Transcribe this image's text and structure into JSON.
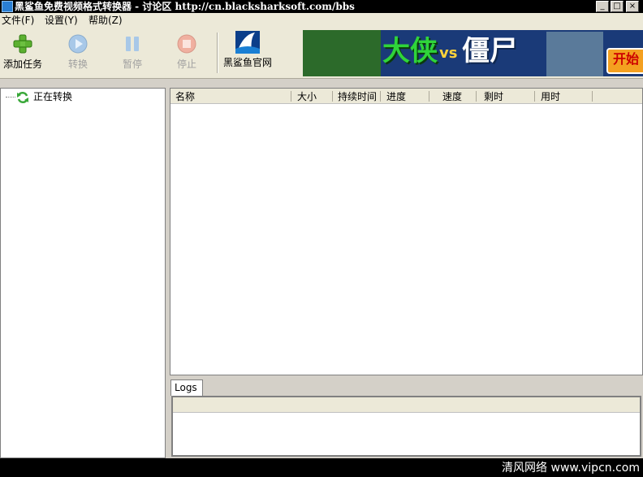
{
  "window": {
    "title": "黑鲨鱼免费视频格式转换器 - 讨论区 http://cn.blacksharksoft.com/bbs"
  },
  "menu": {
    "items": [
      "文件(F)",
      "设置(Y)",
      "帮助(Z)"
    ]
  },
  "toolbar": {
    "add_label": "添加任务",
    "convert_label": "转换",
    "pause_label": "暂停",
    "stop_label": "停止",
    "site_label": "黑鲨鱼官网"
  },
  "banner": {
    "text_left": "大侠",
    "text_vs": "vs",
    "text_right": "僵尸",
    "start": "开始"
  },
  "tree": {
    "node_label": "正在转换"
  },
  "list": {
    "columns": [
      "名称",
      "大小",
      "持续时间",
      "进度",
      "速度",
      "剩时",
      "用时"
    ]
  },
  "logs": {
    "tab_label": "Logs"
  },
  "watermark": "清风网络 www.vipcn.com",
  "colors": {
    "titlebar_bg": "#000000",
    "add_icon": "#5cb030",
    "shark_accent": "#1a7fd4"
  }
}
